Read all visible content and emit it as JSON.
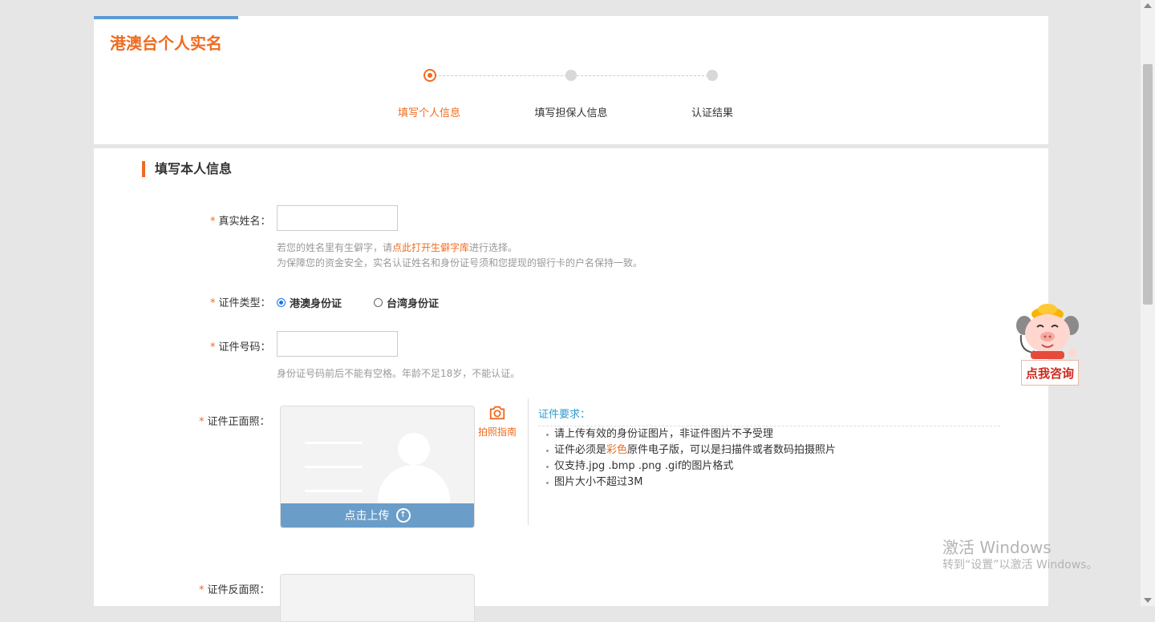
{
  "page_title": "港澳台个人实名",
  "steps": [
    {
      "label": "填写个人信息",
      "active": true
    },
    {
      "label": "填写担保人信息",
      "active": false
    },
    {
      "label": "认证结果",
      "active": false
    }
  ],
  "section_title": "填写本人信息",
  "required_mark": "*",
  "name_field": {
    "label": "真实姓名：",
    "value": "",
    "hint_prefix": "若您的姓名里有生僻字，请",
    "hint_link": "点此打开生僻字库",
    "hint_suffix": "进行选择。",
    "hint_line2": "为保障您的资金安全，实名认证姓名和身份证号须和您提现的银行卡的户名保持一致。"
  },
  "id_type": {
    "label": "证件类型：",
    "options": [
      {
        "label": "港澳身份证",
        "checked": true
      },
      {
        "label": "台湾身份证",
        "checked": false
      }
    ]
  },
  "id_number": {
    "label": "证件号码：",
    "value": "",
    "hint": "身份证号码前后不能有空格。年龄不足18岁，不能认证。"
  },
  "front_photo": {
    "label": "证件正面照：",
    "upload_label": "点击上传",
    "guide_label": "拍照指南",
    "guide_icon": "camera-icon"
  },
  "back_photo": {
    "label": "证件反面照："
  },
  "requirements": {
    "title": "证件要求：",
    "item1": "请上传有效的身份证图片，非证件图片不予受理",
    "item2_pre": "证件必须是",
    "item2_hl": "彩色",
    "item2_post": "原件电子版，可以是扫描件或者数码拍摄照片",
    "item3": "仅支持.jpg .bmp .png .gif的图片格式",
    "item4": "图片大小不超过3M"
  },
  "consult_label": "点我咨询",
  "watermark": {
    "line1": "激活 Windows",
    "line2": "转到“设置”以激活 Windows。"
  },
  "colors": {
    "accent": "#f06b1f",
    "upload_bar": "#6a9dc8",
    "req_title": "#2f9bd0"
  }
}
